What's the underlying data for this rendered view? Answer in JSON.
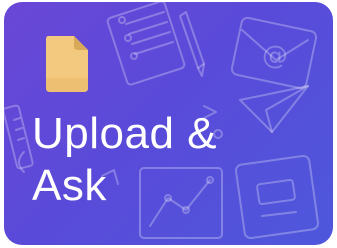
{
  "card": {
    "title_line1": "Upload &",
    "title_line2": "Ask",
    "icon": "document-icon",
    "background_start": "#6a47d6",
    "background_end": "#4d58dc",
    "icon_color": "#f2c97e"
  }
}
